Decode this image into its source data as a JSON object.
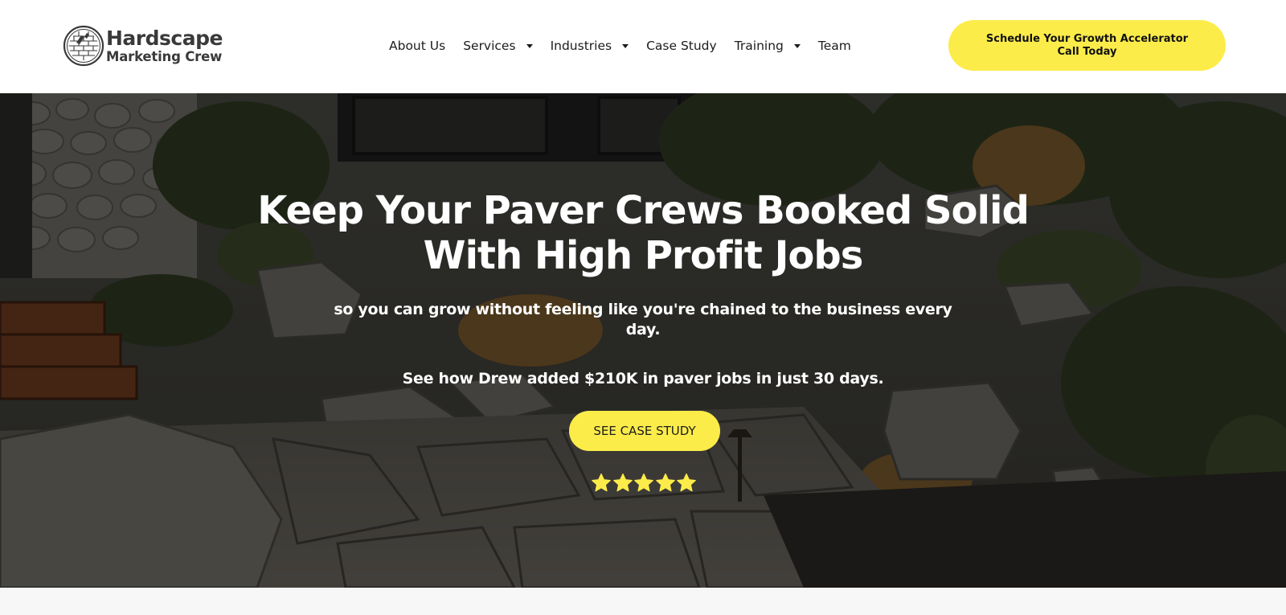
{
  "header": {
    "logo": {
      "line1": "Hardscape",
      "line2": "Marketing Crew",
      "icon": "paver-circle-logo-icon"
    },
    "nav": [
      {
        "label": "About Us",
        "has_dropdown": false
      },
      {
        "label": "Services",
        "has_dropdown": true
      },
      {
        "label": "Industries",
        "has_dropdown": true
      },
      {
        "label": "Case Study",
        "has_dropdown": false
      },
      {
        "label": "Training",
        "has_dropdown": true
      },
      {
        "label": "Team",
        "has_dropdown": false
      }
    ],
    "cta_label": "Schedule Your Growth Accelerator Call Today"
  },
  "hero": {
    "title_line1": "Keep Your Paver Crews Booked Solid",
    "title_line2": "With High Profit Jobs",
    "subtitle": "so you can grow without feeling like you're chained to the business every day.",
    "proof": "See how Drew added $210K in paver jobs in just 30 days.",
    "button_label": "SEE CASE STUDY",
    "rating": 5,
    "rating_max": 5
  },
  "colors": {
    "accent": "#fcec4a",
    "text_dark": "#1c1c1c",
    "logo_gray": "#3a3a3a",
    "hero_text": "#ffffff"
  }
}
